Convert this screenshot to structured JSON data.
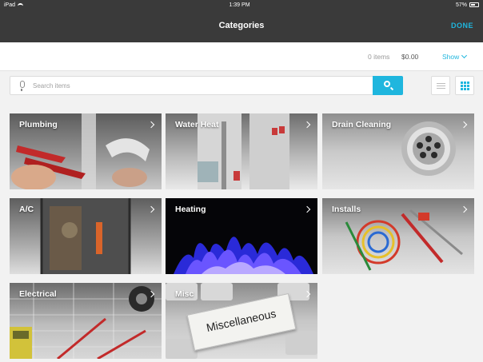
{
  "status_bar": {
    "device": "iPad",
    "time": "1:39 PM",
    "battery": "57%"
  },
  "header": {
    "title": "Categories",
    "done_label": "DONE"
  },
  "summary": {
    "items_count": "0 items",
    "total": "$0.00",
    "show_label": "Show"
  },
  "search": {
    "placeholder": "Search items"
  },
  "colors": {
    "accent": "#1fb6de",
    "header_bg": "#3a3a3a",
    "page_bg": "#f2f2f2"
  },
  "categories": [
    {
      "label": "Plumbing"
    },
    {
      "label": "Water Heat"
    },
    {
      "label": "Drain Cleaning"
    },
    {
      "label": "A/C"
    },
    {
      "label": "Heating"
    },
    {
      "label": "Installs"
    },
    {
      "label": "Electrical"
    },
    {
      "label": "Misc"
    }
  ],
  "misc_tile": {
    "tag_text": "Miscellaneous"
  }
}
